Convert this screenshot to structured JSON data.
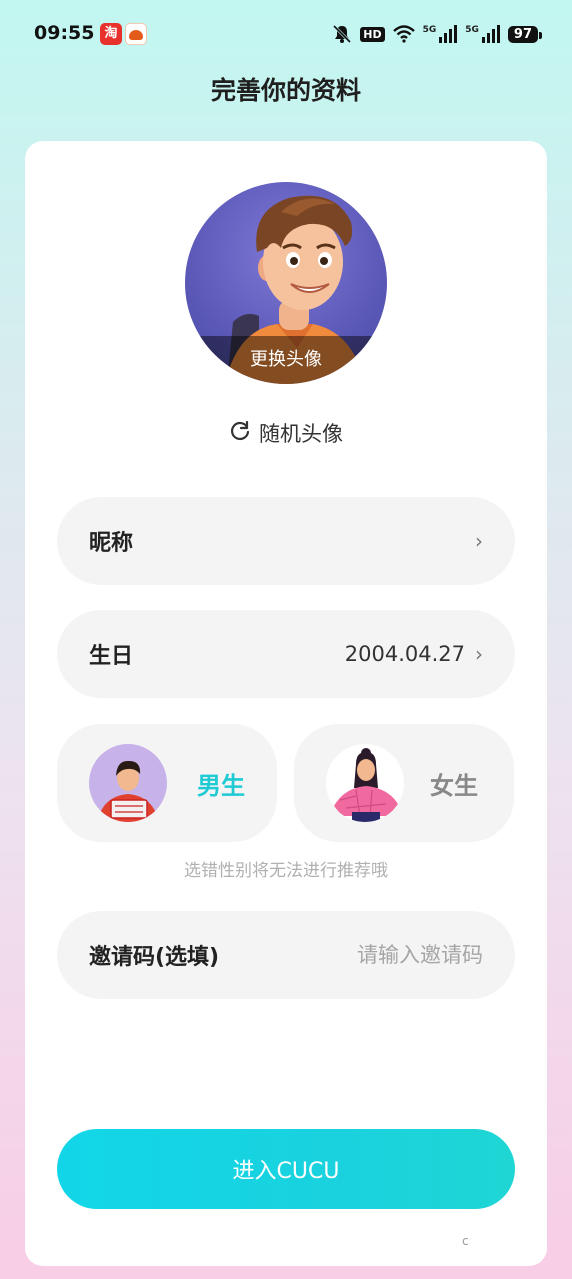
{
  "status_bar": {
    "time": "09:55",
    "network_label": "HD",
    "sim1_label": "5G",
    "sim2_label": "5G",
    "battery": "97",
    "icons": [
      "taobao-app-icon",
      "meituan-app-icon",
      "mute-icon",
      "hd-icon",
      "wifi-icon",
      "signal-icon",
      "signal-icon",
      "battery-icon"
    ]
  },
  "page": {
    "title": "完善你的资料"
  },
  "avatar": {
    "change_label": "更换头像",
    "random_label": "随机头像"
  },
  "fields": {
    "nickname_label": "昵称",
    "birthday_label": "生日",
    "birthday_value": "2004.04.27",
    "invite_label": "邀请码(选填)",
    "invite_placeholder": "请输入邀请码"
  },
  "gender": {
    "male_label": "男生",
    "female_label": "女生",
    "selected": "male",
    "hint": "选错性别将无法进行推荐哦"
  },
  "submit": {
    "label": "进入CUCU"
  },
  "colors": {
    "accent": "#1fcad3",
    "button_gradient_start": "#12d6e8",
    "button_gradient_end": "#1fd6d4"
  }
}
